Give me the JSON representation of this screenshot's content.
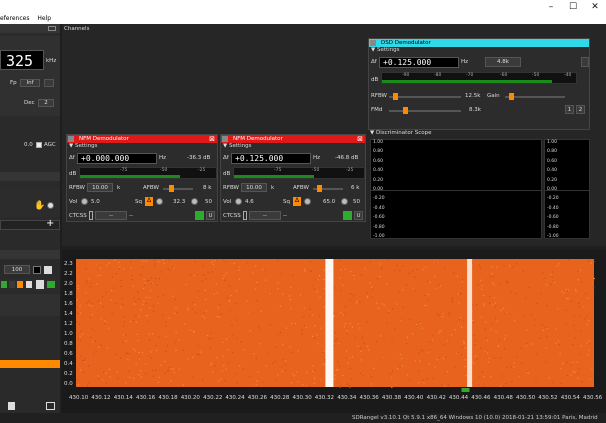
{
  "menu": {
    "items": [
      "eferences",
      "Help"
    ]
  },
  "left": {
    "freq_digits": "325",
    "freq_unit": "kHz",
    "fp_label": "Fp",
    "fp_value": "Inf",
    "dec_label": "Dec",
    "dec_value": "2",
    "agc_value": "0.0",
    "agc_label": "AGC",
    "gain_value": "100"
  },
  "channels": {
    "title": "Channels"
  },
  "nfm1": {
    "title": "NFM Demodulator",
    "settings": "Settings",
    "df_label": "Δf",
    "freq": "+0.000.000",
    "hz": "Hz",
    "level": "-36.3 dB",
    "db_label": "dB",
    "scale": [
      "-75",
      "-50",
      "-25"
    ],
    "rfbw_label": "RFBW",
    "rfbw_value": "10.00",
    "rfbw_unit": "k",
    "afbw_label": "AFBW",
    "afbw_value": "8 k",
    "vol_label": "Vol",
    "vol_value": "5.0",
    "sq_label": "Sq",
    "sq_value": "32.3",
    "sq_value2": "50",
    "ctcss_label": "CTCSS",
    "ctcss_value": "--",
    "ctcss_extra": "--"
  },
  "nfm2": {
    "title": "NFM Demodulator",
    "settings": "Settings",
    "df_label": "Δf",
    "freq": "+0.125.000",
    "hz": "Hz",
    "level": "-46.8 dB",
    "db_label": "dB",
    "scale": [
      "-75",
      "-50",
      "-25"
    ],
    "rfbw_label": "RFBW",
    "rfbw_value": "10.00",
    "rfbw_unit": "k",
    "afbw_label": "AFBW",
    "afbw_value": "6 k",
    "vol_label": "Vol",
    "vol_value": "4.6",
    "sq_label": "Sq",
    "sq_value": "65.0",
    "sq_value2": "50",
    "ctcss_label": "CTCSS",
    "ctcss_value": "--",
    "ctcss_extra": "--"
  },
  "dsd": {
    "title": "DSD Demodulator",
    "settings": "Settings",
    "df_label": "Δf",
    "freq": "+0.125.000",
    "hz": "Hz",
    "bw_value": "4.8k",
    "db_label": "dB",
    "scale": [
      "-90",
      "-80",
      "-70",
      "-60",
      "-50",
      "-40"
    ],
    "rfbw_label": "RFBW",
    "rfbw_value": "12.5k",
    "gain_label": "Gain",
    "fmd_label": "FMd",
    "fmd_value": "8.3k",
    "btn1": "1",
    "btn2": "2"
  },
  "scope": {
    "title": "Discriminator Scope",
    "y_ticks": [
      "1.00",
      "0.80",
      "0.60",
      "0.40",
      "0.20",
      "0.00",
      "-0.20",
      "-0.40",
      "-0.60",
      "-0.80",
      "-1.00"
    ]
  },
  "waterfall": {
    "y_ticks": [
      "2.3",
      "2.2",
      "2.0",
      "1.8",
      "1.6",
      "1.4",
      "1.2",
      "1.0",
      "0.8",
      "0.6",
      "0.4",
      "0.2",
      "0.0"
    ],
    "x_ticks": [
      "430.10",
      "430.12",
      "430.14",
      "430.16",
      "430.18",
      "430.20",
      "430.22",
      "430.24",
      "430.26",
      "430.28",
      "430.30",
      "430.32",
      "430.34",
      "430.36",
      "430.38",
      "430.40",
      "430.42",
      "430.44",
      "430.46",
      "430.48",
      "430.50",
      "430.52",
      "430.54",
      "430.56"
    ],
    "background_color": "#e8641e",
    "signal_color": "#ffffff"
  },
  "status": {
    "text": "SDRangel v3.10.1 Qt 5.9.1 x86_64 Windows 10 (10.0)  2018-01-21 13:59:01 Paris, Madrid"
  },
  "colors": {
    "nfm_header": "#e01818",
    "dsd_header": "#30d8e8",
    "accent_orange": "#ff8a00",
    "green": "#2eaa2e"
  }
}
